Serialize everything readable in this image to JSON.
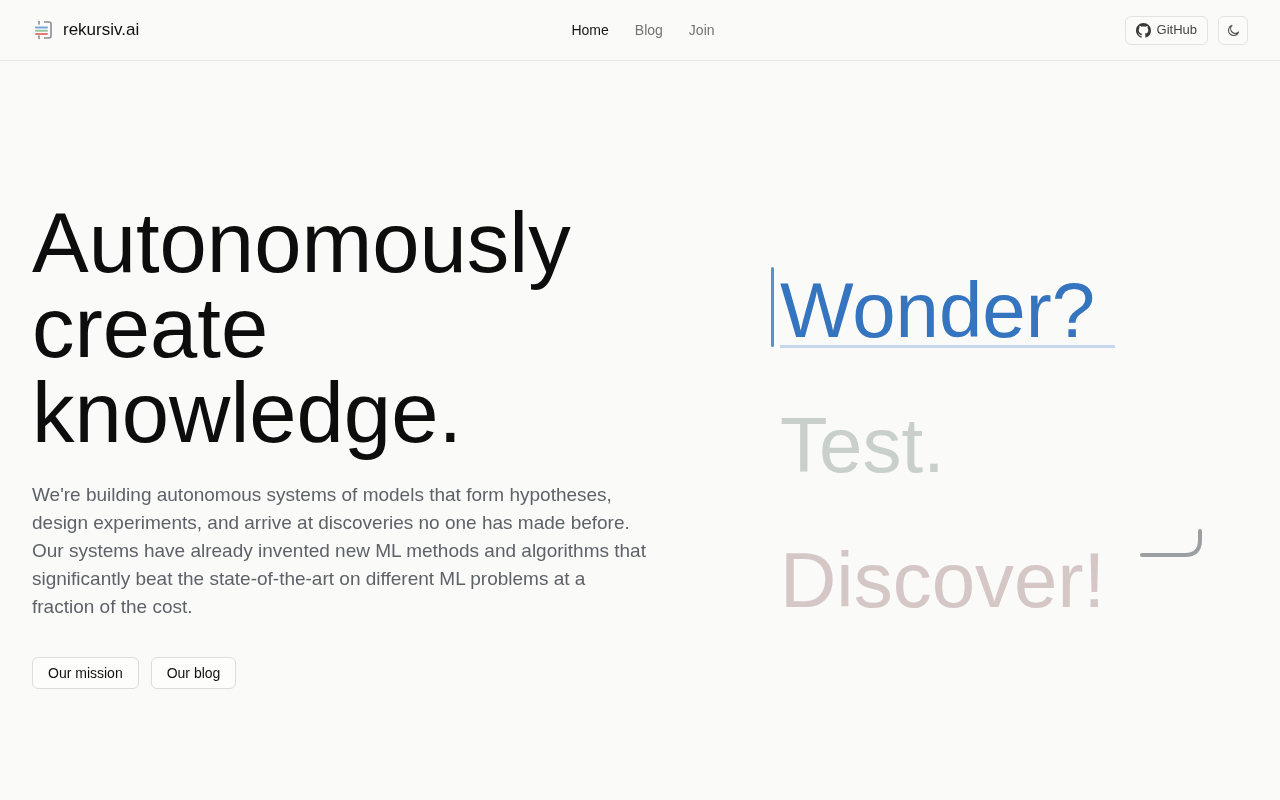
{
  "header": {
    "brand": "rekursiv.ai",
    "nav": [
      {
        "label": "Home",
        "selected": true
      },
      {
        "label": "Blog",
        "selected": false
      },
      {
        "label": "Join",
        "selected": false
      }
    ],
    "github_button": "GitHub"
  },
  "hero": {
    "heading": "Autonomously create knowledge.",
    "body": "We're building autonomous systems of models that form hypotheses, design experiments, and arrive at discoveries no one has made before. Our systems have already invented new ML methods and algorithms that significantly beat the state-of-the-art on different ML problems at a fraction of the cost.",
    "buttons": [
      "Our mission",
      "Our blog"
    ]
  },
  "words": [
    {
      "text": "Wonder?",
      "selected": true,
      "color": "#3574be"
    },
    {
      "text": "Test.",
      "selected": false,
      "color": "#c9d0cb"
    },
    {
      "text": "Discover!",
      "selected": false,
      "color": "#d6c7c7"
    }
  ]
}
